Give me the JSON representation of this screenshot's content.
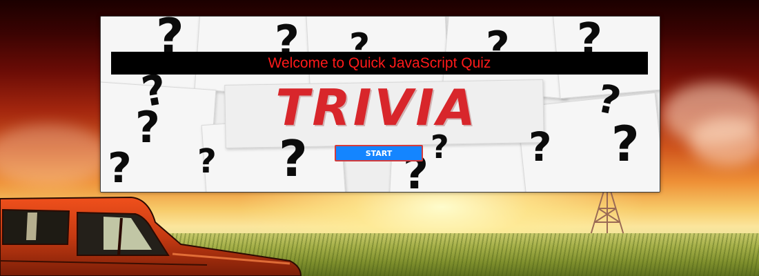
{
  "header": {
    "title": "Welcome to Quick JavaScript Quiz"
  },
  "hero": {
    "logo_text": "TRIVIA",
    "decoration_glyph": "?"
  },
  "actions": {
    "start_label": "START"
  },
  "colors": {
    "title_text": "#ff1a1a",
    "title_bar": "#000000",
    "trivia_text": "#d8262b",
    "start_button": "#1485ff",
    "start_border": "#d43a3a"
  },
  "icons": [
    "question-mark-icon",
    "truck-illustration",
    "windmill-tower-illustration"
  ]
}
